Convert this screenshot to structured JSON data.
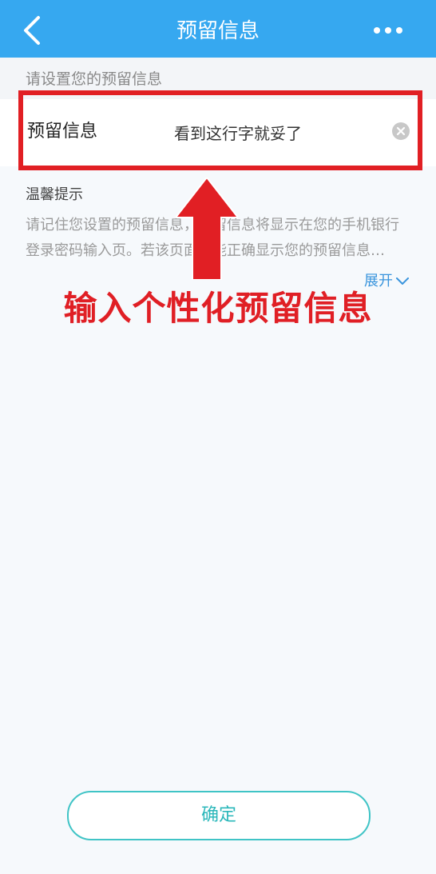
{
  "header": {
    "title": "预留信息",
    "back_icon": "chevron-left-icon",
    "more_icon": "more-dots-icon",
    "bg_color": "#36a8f0"
  },
  "section_hint": "请设置您的预留信息",
  "input_row": {
    "label": "预留信息",
    "value": "看到这行字就妥了",
    "clear_icon": "clear-icon"
  },
  "tips": {
    "title": "温馨提示",
    "line1": "请记住您设置的预留信息，预留信息将显示在您的手机银行",
    "line2": "登录密码输入页。若该页面未能正确显示您的预留信息…",
    "expand_label": "展开",
    "expand_icon": "chevron-down-icon"
  },
  "annotation": {
    "callout": "输入个性化预留信息",
    "color": "#e11f24"
  },
  "confirm": {
    "label": "确定",
    "accent": "#40c4c6"
  }
}
